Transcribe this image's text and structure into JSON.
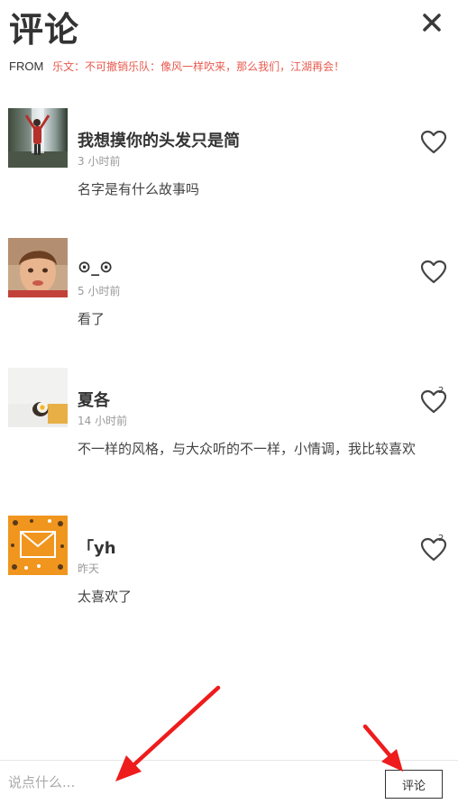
{
  "header": {
    "title": "评论",
    "from_label": "FROM",
    "source": "乐文：不可撤销乐队：像风一样吹来，那么我们，江湖再会！",
    "close_icon": "close-icon"
  },
  "comments": [
    {
      "user": "我想摸你的头发只是简",
      "time": "3 小时前",
      "text": "名字是有什么故事吗",
      "likes": "",
      "avatar": "waterfall-photo"
    },
    {
      "user": "⊙_⊙",
      "time": "5 小时前",
      "text": "看了",
      "likes": "",
      "avatar": "child-photo"
    },
    {
      "user": "夏各",
      "time": "14 小时前",
      "text": "不一样的风格，与大众听的不一样，小情调，我比较喜欢",
      "likes": "2",
      "avatar": "egg-photo"
    },
    {
      "user": "「yh",
      "time": "昨天",
      "text": "太喜欢了",
      "likes": "2",
      "avatar": "envelope-illustration"
    }
  ],
  "footer": {
    "placeholder": "说点什么...",
    "submit_label": "评论"
  },
  "colors": {
    "accent": "#e85a4f",
    "arrow": "#ee1c1c",
    "text": "#333333",
    "muted": "#999999"
  },
  "icons": [
    "close-icon",
    "heart-icon",
    "arrow-icon"
  ]
}
